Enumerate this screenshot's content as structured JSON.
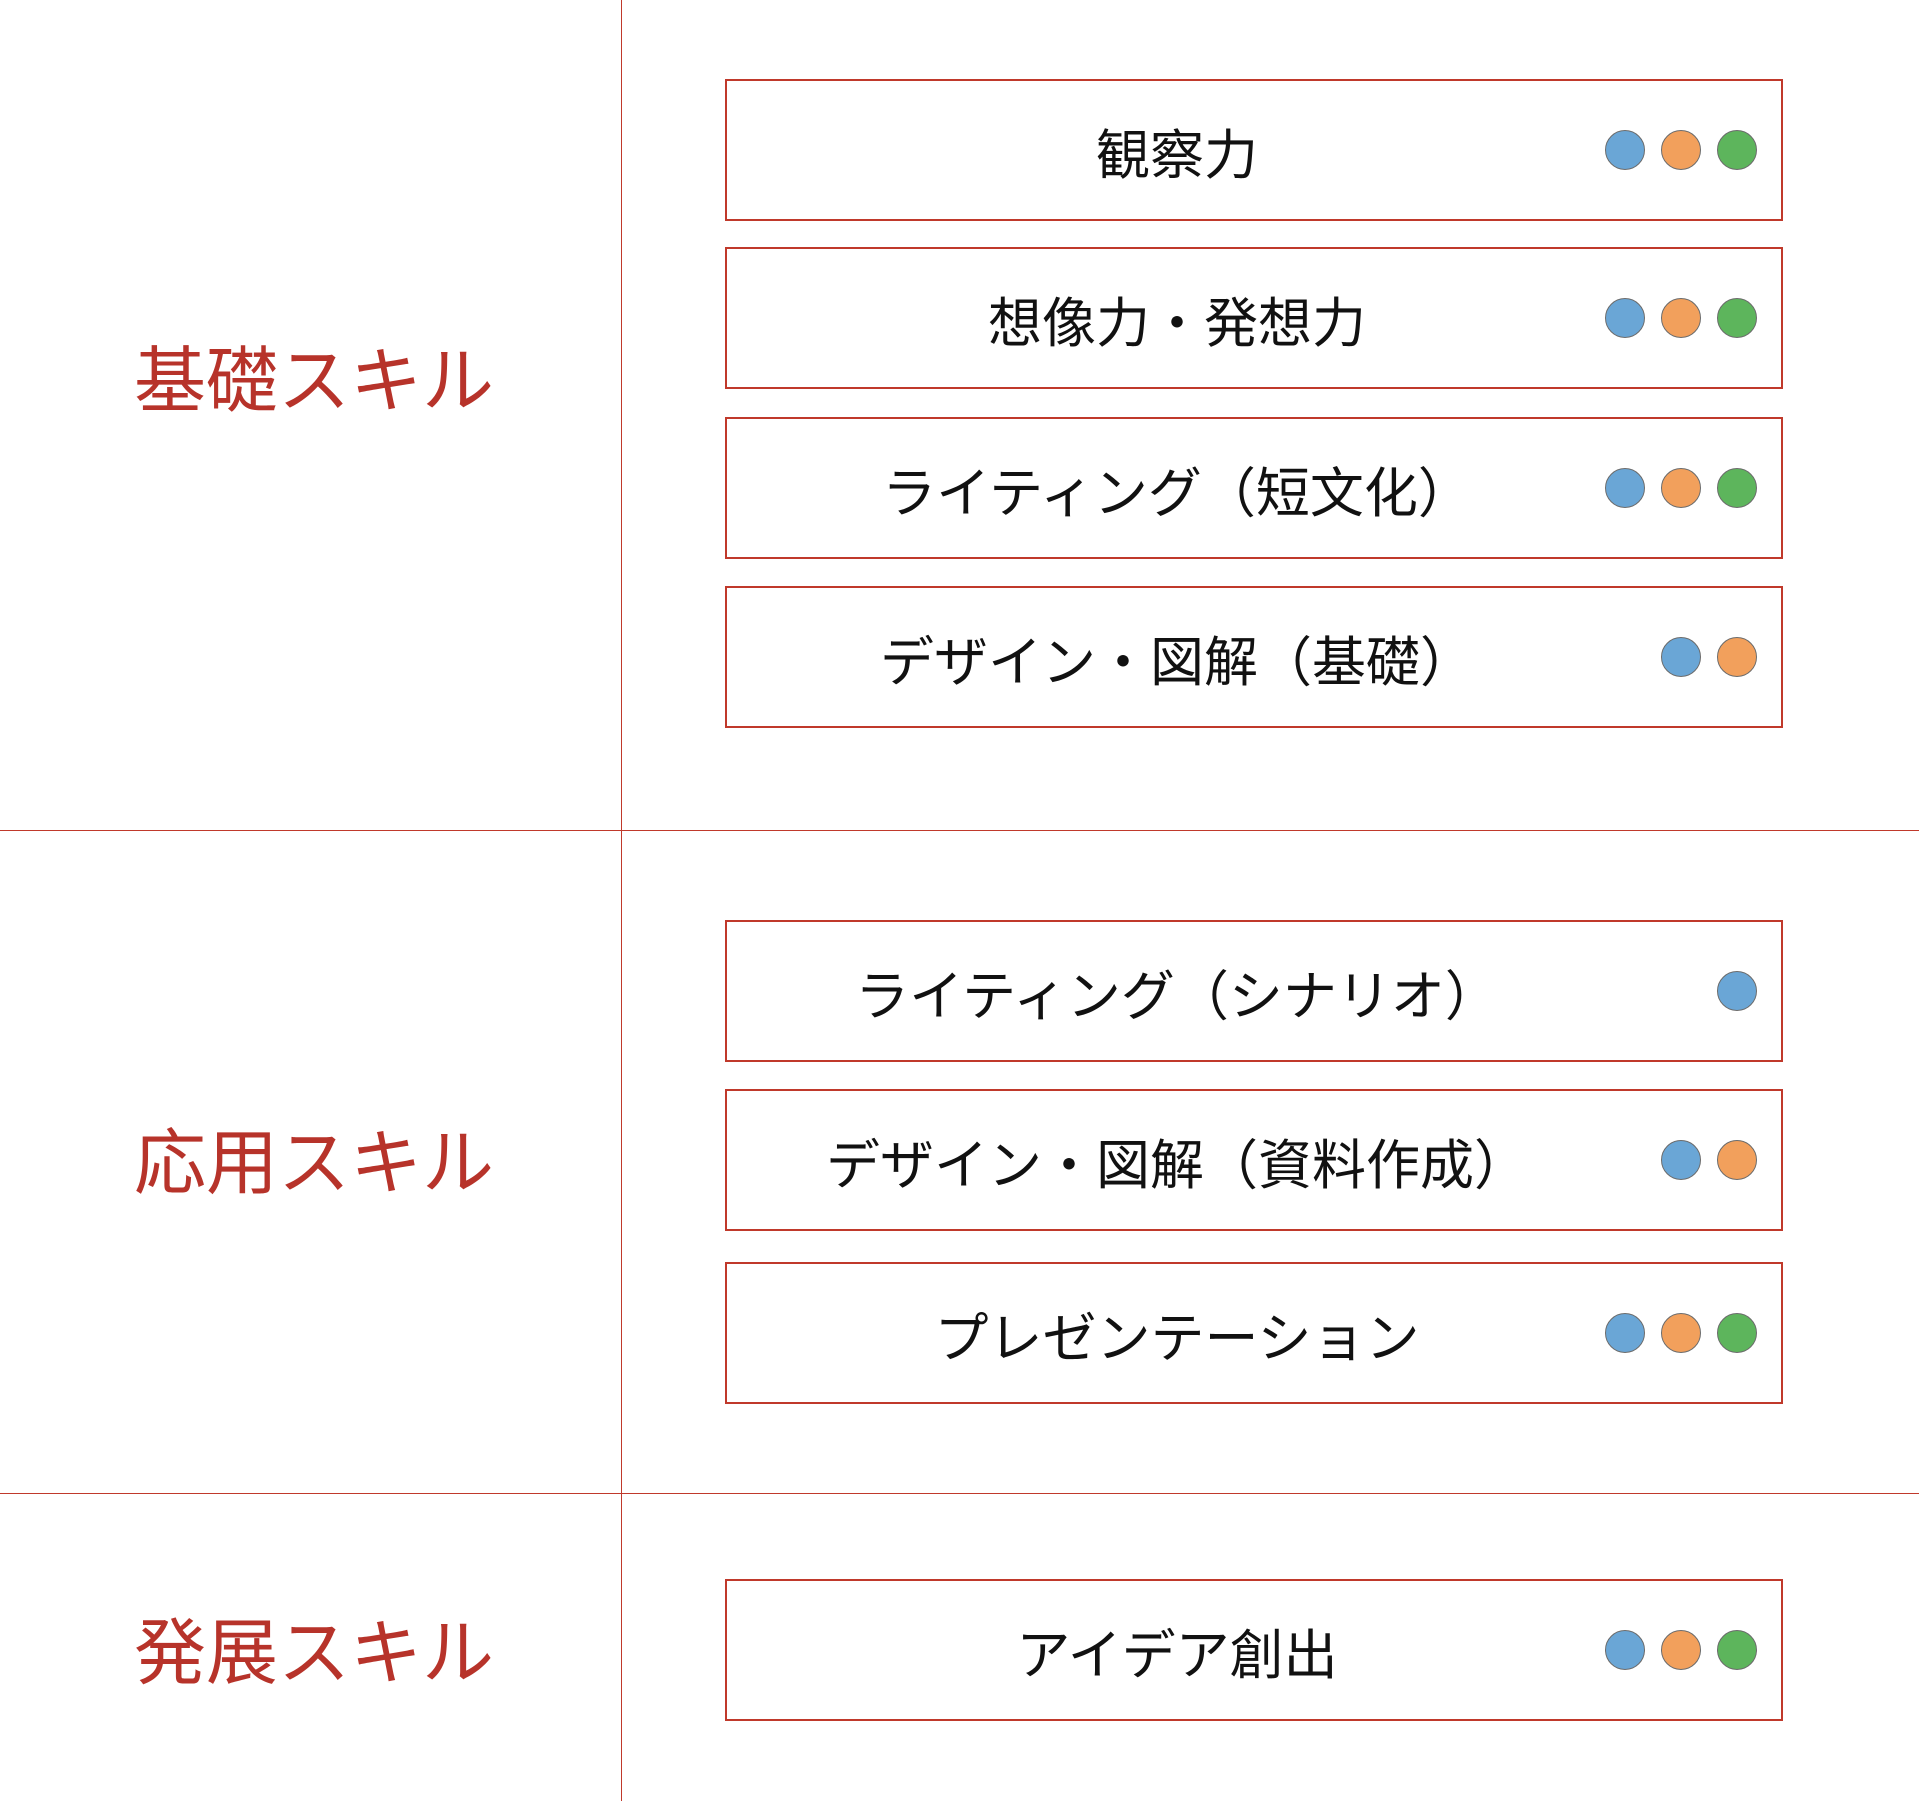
{
  "colors": {
    "accent_red": "#c0392b",
    "dot_blue": "#6aa6d6",
    "dot_orange": "#f2a05c",
    "dot_green": "#5db55c"
  },
  "categories": [
    {
      "label": "基礎スキル",
      "skills": [
        {
          "label": "観察力",
          "dots": [
            "blue",
            "orange",
            "green"
          ]
        },
        {
          "label": "想像力・発想力",
          "dots": [
            "blue",
            "orange",
            "green"
          ]
        },
        {
          "label": "ライティング（短文化）",
          "dots": [
            "blue",
            "orange",
            "green"
          ]
        },
        {
          "label": "デザイン・図解（基礎）",
          "dots": [
            "blue",
            "orange"
          ]
        }
      ]
    },
    {
      "label": "応用スキル",
      "skills": [
        {
          "label": "ライティング（シナリオ）",
          "dots": [
            "blue"
          ]
        },
        {
          "label": "デザイン・図解（資料作成）",
          "dots": [
            "blue",
            "orange"
          ]
        },
        {
          "label": "プレゼンテーション",
          "dots": [
            "blue",
            "orange",
            "green"
          ]
        }
      ]
    },
    {
      "label": "発展スキル",
      "skills": [
        {
          "label": "アイデア創出",
          "dots": [
            "blue",
            "orange",
            "green"
          ]
        }
      ]
    }
  ]
}
